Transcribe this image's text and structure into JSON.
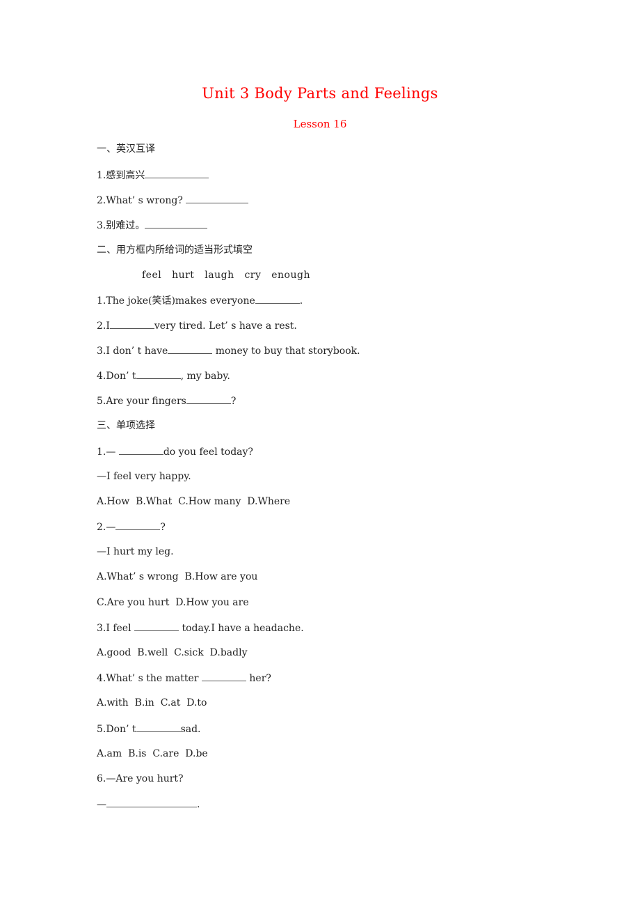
{
  "header": {
    "title": "Unit 3 Body Parts and Feelings",
    "subtitle": "Lesson 16",
    "title_color": "#ff0000"
  },
  "section1": {
    "heading": "一、英汉互译",
    "items": [
      {
        "before": "1.感到高兴",
        "after": ""
      },
      {
        "before": "2.What’ s wrong? ",
        "after": ""
      },
      {
        "before": "3.别难过。",
        "after": ""
      }
    ]
  },
  "section2": {
    "heading": "二、用方框内所给词的适当形式填空",
    "word_box": "feel   hurt   laugh   cry   enough",
    "items": [
      {
        "before": "1.The joke(笑话)makes everyone",
        "after": "."
      },
      {
        "before": "2.I",
        "after": "very tired. Let’ s have a rest."
      },
      {
        "before": "3.I don’ t have",
        "after": " money to buy that storybook."
      },
      {
        "before": "4.Don’ t",
        "after": ", my baby."
      },
      {
        "before": "5.Are your fingers",
        "after": "?"
      }
    ]
  },
  "section3": {
    "heading": "三、单项选择",
    "q1": {
      "before": "1.— ",
      "after": "do you feel today?",
      "reply": "—I feel very happy.",
      "options": "A.How  B.What  C.How many  D.Where"
    },
    "q2": {
      "before": "2.—",
      "after": "?",
      "reply": "—I hurt my leg.",
      "options1": "A.What’ s wrong  B.How are you",
      "options2": "C.Are you hurt  D.How you are"
    },
    "q3": {
      "before": "3.I feel ",
      "after": " today.I have a headache.",
      "options": "A.good  B.well  C.sick  D.badly"
    },
    "q4": {
      "before": "4.What’ s the matter ",
      "after": " her?",
      "options": "A.with  B.in  C.at  D.to"
    },
    "q5": {
      "before": "5.Don’ t",
      "after": "sad.",
      "options": "A.am  B.is  C.are  D.be"
    },
    "q6": {
      "prompt": "6.—Are you hurt?",
      "before": "—",
      "after": "."
    }
  }
}
